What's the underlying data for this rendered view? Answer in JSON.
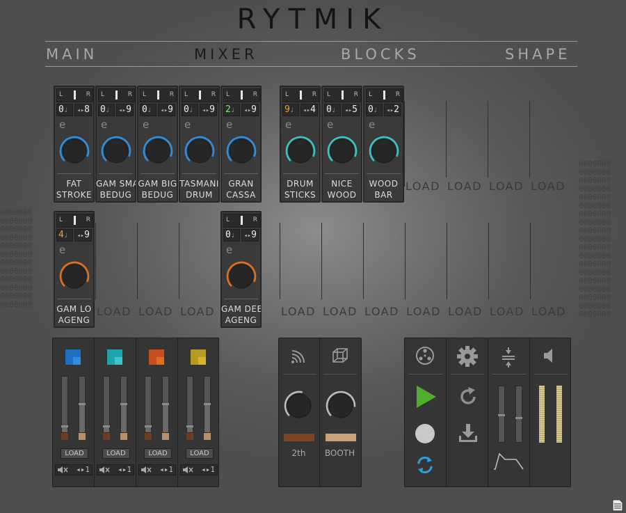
{
  "app": {
    "title": "RYTMIK"
  },
  "tabs": [
    {
      "label": "MAIN",
      "active": false
    },
    {
      "label": "MIXER",
      "active": true
    },
    {
      "label": "BLOCKS",
      "active": false
    },
    {
      "label": "SHAPE",
      "active": false
    }
  ],
  "colors": {
    "knob_blue": "#2f8fe0",
    "knob_teal": "#3cc6c9",
    "knob_orange": "#e0701c",
    "play_green": "#4fae2e",
    "loop_blue": "#2d9fe0",
    "active_tab": "#1a1a1a",
    "inactive_tab": "#a8a8a8"
  },
  "channel_common": {
    "left": "L",
    "right": "R",
    "expr": "e",
    "note_sym": "♩",
    "arrow_sym": "◂▸"
  },
  "row1_channels": [
    {
      "n1": "0",
      "n2": "8",
      "line1": "FAT",
      "line2": "STROKE",
      "knob": "blue",
      "n1_color": "#eeeeee"
    },
    {
      "n1": "0",
      "n2": "9",
      "line1": "GAM SMA",
      "line2": "BEDUG",
      "knob": "blue",
      "n1_color": "#eeeeee"
    },
    {
      "n1": "0",
      "n2": "9",
      "line1": "GAM BIG",
      "line2": "BEDUG",
      "knob": "blue",
      "n1_color": "#eeeeee"
    },
    {
      "n1": "0",
      "n2": "9",
      "line1": "TASMANI",
      "line2": "DRUM",
      "knob": "blue",
      "n1_color": "#eeeeee"
    },
    {
      "n1": "2",
      "n2": "9",
      "line1": "GRAN",
      "line2": "CASSA",
      "knob": "blue",
      "n1_color": "#8fe08a"
    },
    {
      "n1": "9",
      "n2": "4",
      "line1": "DRUM",
      "line2": "STICKS",
      "knob": "teal",
      "n1_color": "#e8a03c"
    },
    {
      "n1": "0",
      "n2": "5",
      "line1": "NICE",
      "line2": "WOOD",
      "knob": "teal",
      "n1_color": "#eeeeee"
    },
    {
      "n1": "0",
      "n2": "2",
      "line1": "WOOD",
      "line2": "BAR",
      "knob": "teal",
      "n1_color": "#eeeeee"
    }
  ],
  "row2_channels": [
    {
      "n1": "4",
      "n2": "9",
      "line1": "GAM LO",
      "line2": "AGENG",
      "knob": "orange",
      "n1_color": "#e8a03c"
    },
    {
      "n1": "0",
      "n2": "9",
      "line1": "GAM DEE",
      "line2": "AGENG",
      "knob": "orange",
      "n1_color": "#eeeeee"
    }
  ],
  "load_label": "LOAD",
  "groups": [
    {
      "color": "#1f6fc4",
      "accent": "#2f8fe0",
      "load": "LOAD",
      "mute_text": "◂▸1"
    },
    {
      "color": "#1fa4ac",
      "accent": "#3cc6c9",
      "load": "LOAD",
      "mute_text": "◂▸1"
    },
    {
      "color": "#c4501f",
      "accent": "#e0701c",
      "load": "LOAD",
      "mute_text": "◂▸1"
    },
    {
      "color": "#b89a1f",
      "accent": "#d8b42a",
      "load": "LOAD",
      "mute_text": "◂▸1"
    }
  ],
  "fx": [
    {
      "label": "2th",
      "icon": "reverb-icon",
      "level": 0.55
    },
    {
      "label": "BOOTH",
      "icon": "cube-icon",
      "level": 0.85
    }
  ],
  "transport": {
    "icons": [
      "record-reel-icon",
      "play-icon",
      "record-icon",
      "loop-icon"
    ],
    "settings_icons": [
      "gear-icon",
      "refresh-icon",
      "download-icon"
    ],
    "mix_icons": [
      "compress-icon",
      "envelope-icon"
    ],
    "master_icon": "speaker-icon"
  }
}
